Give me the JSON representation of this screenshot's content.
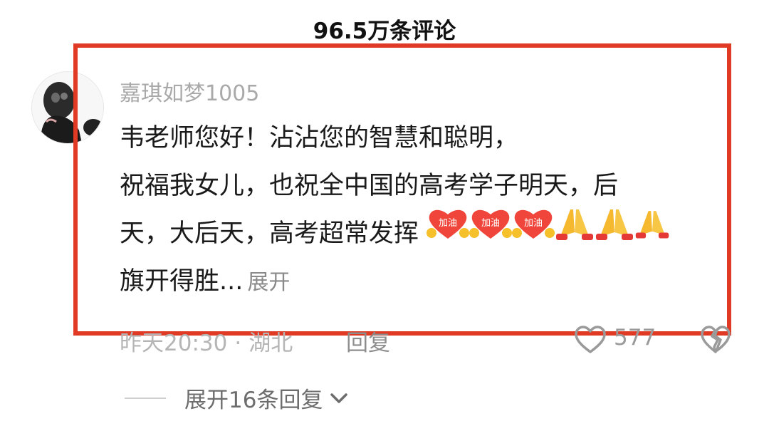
{
  "header": {
    "comment_count": "96.5万条评论"
  },
  "comment": {
    "username": "嘉琪如梦1005",
    "lines": [
      "韦老师您好！沾沾您的智慧和聪明，",
      "祝福我女儿，也祝全中国的高考学子明天，后",
      "天，大后天，高考超常发挥",
      "旗开得胜..."
    ],
    "expand_label": "展开",
    "emoji_label": "加油",
    "timestamp": "昨天20:30",
    "separator": "·",
    "location": "湖北",
    "reply_label": "回复",
    "like_count": "577"
  },
  "replies": {
    "expand_label": "展开16条回复"
  },
  "colors": {
    "highlight_frame": "#e03a24",
    "username": "#a9a9a9",
    "meta": "#b5b5b5"
  },
  "icons": [
    "avatar",
    "jiayou-emoji",
    "pray-emoji",
    "heart-icon",
    "broken-heart-icon",
    "chevron-down-icon"
  ]
}
